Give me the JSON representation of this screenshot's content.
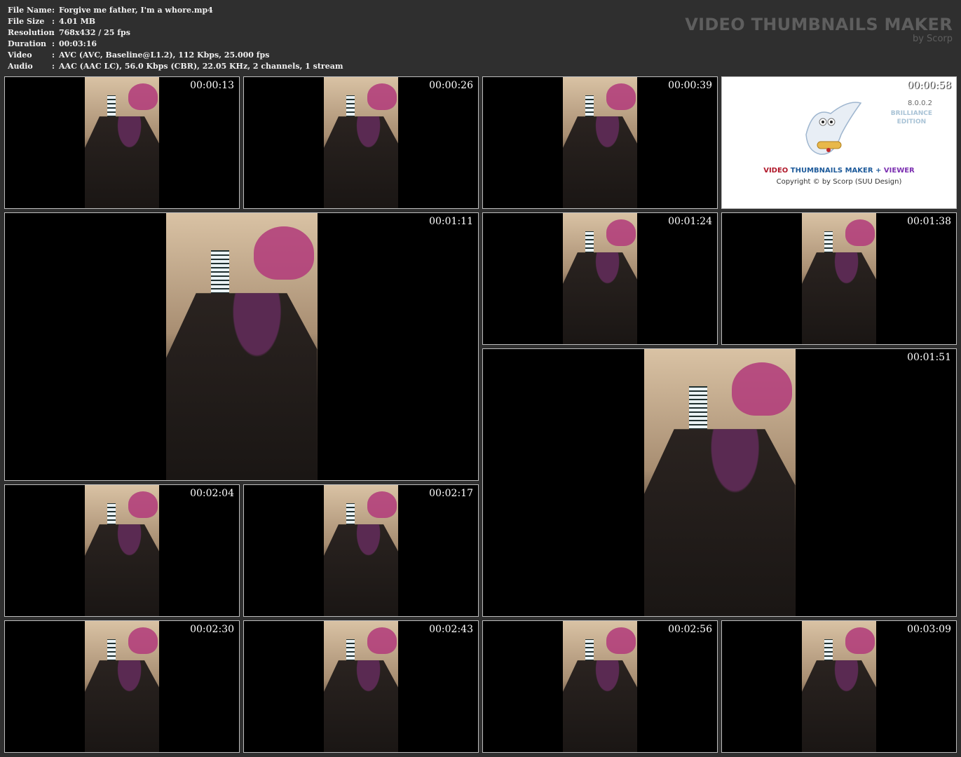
{
  "info": {
    "file_name": {
      "label": "File Name",
      "sep": ":",
      "value": "Forgive me father, I'm a whore.mp4"
    },
    "file_size": {
      "label": "File Size",
      "sep": ":",
      "value": "4.01 MB"
    },
    "resolution": {
      "label": "Resolution",
      "sep": ":",
      "value": "768x432 / 25 fps"
    },
    "duration": {
      "label": "Duration",
      "sep": ":",
      "value": "00:03:16"
    },
    "video": {
      "label": "Video",
      "sep": ":",
      "value": "AVC (AVC, Baseline@L1.2), 112 Kbps, 25.000 fps"
    },
    "audio": {
      "label": "Audio",
      "sep": ":",
      "value": "AAC (AAC LC), 56.0 Kbps (CBR), 22.05 KHz, 2 channels, 1 stream"
    }
  },
  "brand": {
    "title": "VIDEO THUMBNAILS MAKER",
    "sub": "by Scorp"
  },
  "frames": [
    {
      "time": "00:00:13"
    },
    {
      "time": "00:00:26"
    },
    {
      "time": "00:00:39"
    },
    {
      "time": "00:00:58"
    },
    {
      "time": "00:01:11"
    },
    {
      "time": "00:01:24"
    },
    {
      "time": "00:01:38"
    },
    {
      "time": "00:01:51"
    },
    {
      "time": "00:02:04"
    },
    {
      "time": "00:02:17"
    },
    {
      "time": "00:02:30"
    },
    {
      "time": "00:02:43"
    },
    {
      "time": "00:02:56"
    },
    {
      "time": "00:03:09"
    }
  ],
  "splash": {
    "version": "8.0.0.2",
    "edition_1": "BRILLIANCE",
    "edition_2": "EDITION",
    "title_a": "VIDEO",
    "title_b": "THUMBNAILS MAKER",
    "title_plus": "+",
    "title_c": "VIEWER",
    "copyright": "Copyright © by Scorp (SUU Design)"
  },
  "colors": {
    "background": "#2f2f2f",
    "frame_border": "#bdbdbd",
    "brand_text": "#5e5e5e"
  }
}
